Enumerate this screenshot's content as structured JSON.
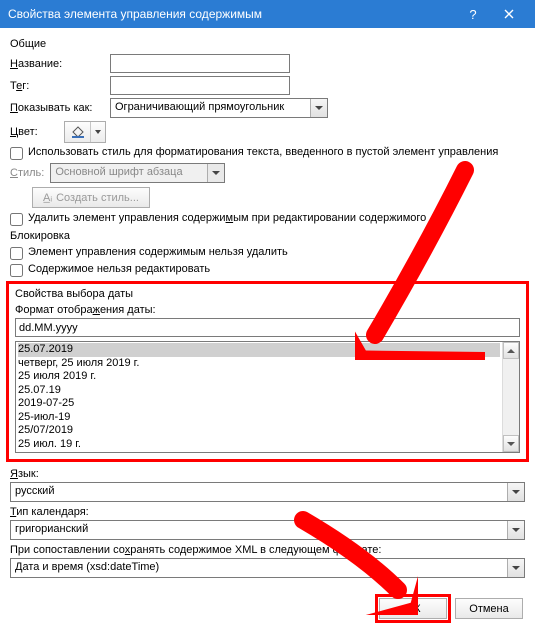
{
  "titlebar": {
    "title": "Свойства элемента управления содержимым"
  },
  "general": {
    "header": "Общие",
    "name_label": "Название:",
    "name_value": "",
    "tag_label": "Тег:",
    "tag_value": "",
    "show_as_label": "Показывать как:",
    "show_as_value": "Ограничивающий прямоугольник",
    "color_label": "Цвет:",
    "use_style_label": "Использовать стиль для форматирования текста, введенного в пустой элемент управления",
    "style_label": "Стиль:",
    "style_value": "Основной шрифт абзаца",
    "create_style_btn": "Создать стиль...",
    "delete_on_edit_label": "Удалить элемент управления содержимым при редактировании содержимого"
  },
  "locking": {
    "header": "Блокировка",
    "no_delete_label": "Элемент управления содержимым нельзя удалить",
    "no_edit_label": "Содержимое нельзя редактировать"
  },
  "date_props": {
    "header": "Свойства выбора даты",
    "format_label": "Формат отображения даты:",
    "format_value": "dd.MM.yyyy",
    "examples": [
      "25.07.2019",
      "четверг, 25 июля 2019 г.",
      "25 июля 2019 г.",
      "25.07.19",
      "2019-07-25",
      "25-июл-19",
      "25/07/2019",
      "25 июл. 19 г."
    ],
    "lang_label": "Язык:",
    "lang_value": "русский",
    "cal_label": "Тип календаря:",
    "cal_value": "григорианский",
    "xml_label": "При сопоставлении сохранять содержимое XML в следующем формате:",
    "xml_value": "Дата и время (xsd:dateTime)"
  },
  "footer": {
    "ok": "ОК",
    "cancel": "Отмена"
  }
}
